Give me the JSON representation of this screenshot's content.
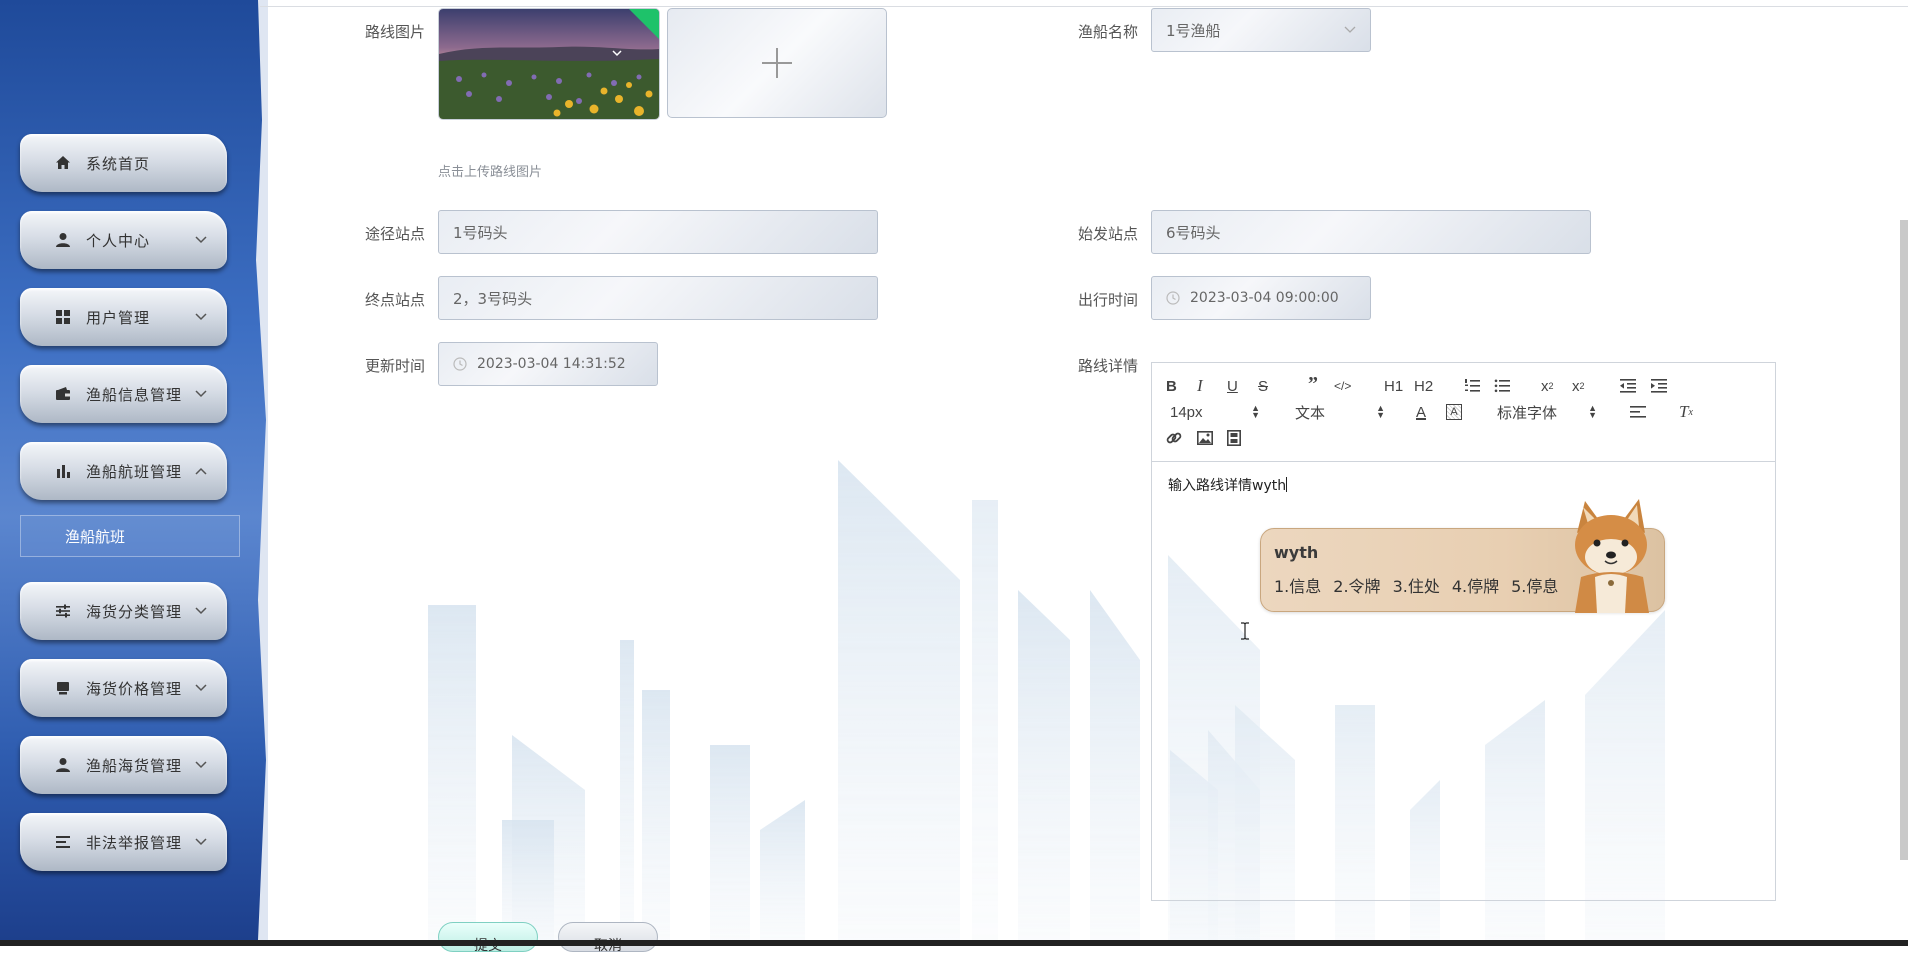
{
  "sidebar": {
    "items": [
      {
        "label": "系统首页",
        "icon": "home-icon",
        "has_chevron": false
      },
      {
        "label": "个人中心",
        "icon": "user-icon",
        "has_chevron": true
      },
      {
        "label": "用户管理",
        "icon": "grid-icon",
        "has_chevron": true
      },
      {
        "label": "渔船信息管理",
        "icon": "wallet-icon",
        "has_chevron": true
      },
      {
        "label": "渔船航班管理",
        "icon": "bar-chart-icon",
        "has_chevron": true,
        "expanded": true
      },
      {
        "label": "海货分类管理",
        "icon": "sliders-icon",
        "has_chevron": true
      },
      {
        "label": "海货价格管理",
        "icon": "box-icon",
        "has_chevron": true
      },
      {
        "label": "渔船海货管理",
        "icon": "user-icon",
        "has_chevron": true
      },
      {
        "label": "非法举报管理",
        "icon": "list-icon",
        "has_chevron": true
      }
    ],
    "submenu": {
      "label": "渔船航班"
    }
  },
  "form": {
    "route_image": {
      "label": "路线图片",
      "hint": "点击上传路线图片"
    },
    "boat_name": {
      "label": "渔船名称",
      "value": "1号渔船"
    },
    "via_station": {
      "label": "途径站点",
      "value": "1号码头"
    },
    "start_station": {
      "label": "始发站点",
      "value": "6号码头"
    },
    "end_station": {
      "label": "终点站点",
      "value": "2，3号码头"
    },
    "depart_time": {
      "label": "出行时间",
      "value": "2023-03-04 09:00:00"
    },
    "update_time": {
      "label": "更新时间",
      "value": "2023-03-04 14:31:52"
    },
    "route_detail": {
      "label": "路线详情",
      "content": "输入路线详情wyth"
    }
  },
  "editor": {
    "toolbar": {
      "font_size": "14px",
      "paragraph": "文本",
      "font_family": "标准字体",
      "h1": "H1",
      "h2": "H2"
    }
  },
  "ime": {
    "input": "wyth",
    "candidates": [
      "1.信息",
      "2.令牌",
      "3.住处",
      "4.停牌",
      "5.停息"
    ]
  },
  "buttons": {
    "submit": "提交",
    "cancel": "取消"
  },
  "colors": {
    "sidebar_top": "#1f4a9a",
    "sidebar_mid": "#5b86cf",
    "field_border": "#b9c2cf",
    "ime_bg": "#e8cfb2"
  }
}
